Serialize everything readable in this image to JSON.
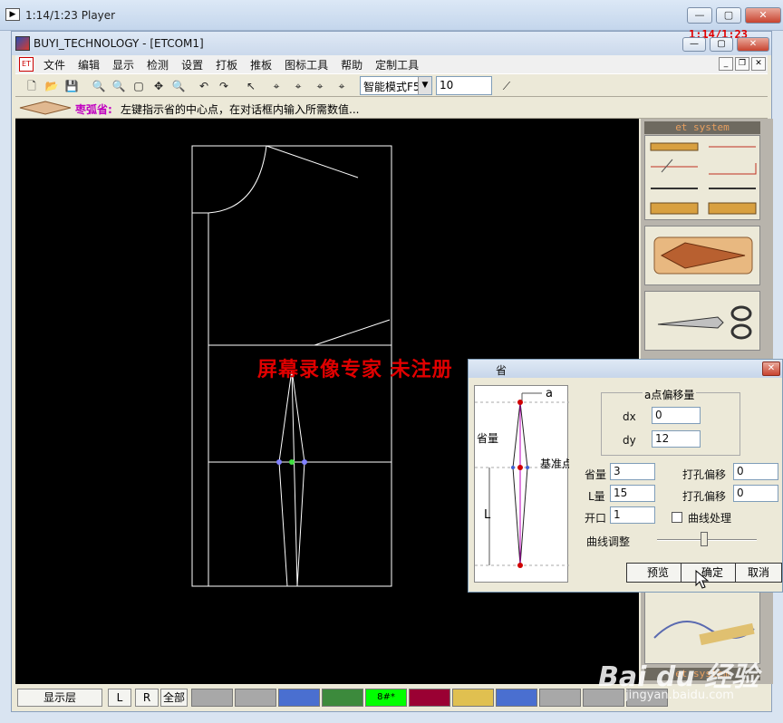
{
  "player": {
    "title": "1:14/1:23 Player"
  },
  "app": {
    "title": "BUYI_TECHNOLOGY - [ETCOM1]",
    "timer": "1:14/1:23",
    "menu": [
      "文件",
      "编辑",
      "显示",
      "检测",
      "设置",
      "打板",
      "推板",
      "图标工具",
      "帮助",
      "定制工具"
    ]
  },
  "toolbar": {
    "mode_select": "智能模式F5",
    "value_input": "10"
  },
  "hint": {
    "label": "枣弧省:",
    "text": "左键指示省的中心点，在对话框内输入所需数值..."
  },
  "palette": {
    "header_top": "et system",
    "header_bottom": "et system"
  },
  "statusbar": {
    "layer_button": "显示层",
    "l_button": "L",
    "r_button": "R",
    "all_button": "全部",
    "swatch_label": "8#*",
    "colors": [
      "#a8a8a8",
      "#a8a8a8",
      "#4a6fd0",
      "#3c8a3c",
      "#00ff00",
      "#9a0033",
      "#e0c050",
      "#4a6fd0",
      "#a8a8a8",
      "#a8a8a8",
      "#a8a8a8"
    ]
  },
  "dialog": {
    "title": "省",
    "preview": {
      "label_a": "a",
      "label_dart": "省量",
      "label_base": "基准点",
      "label_L": "L"
    },
    "offset_group": {
      "title": "a点偏移量",
      "dx_label": "dx",
      "dx_value": "0",
      "dy_label": "dy",
      "dy_value": "12"
    },
    "dart_amount_label": "省量",
    "dart_amount_value": "3",
    "l_amount_label": "L量",
    "l_amount_value": "15",
    "opening_label": "开口",
    "opening_value": "1",
    "hole_offset1_label": "打孔偏移",
    "hole_offset1_value": "0",
    "hole_offset2_label": "打孔偏移",
    "hole_offset2_value": "0",
    "curve_process_label": "曲线处理",
    "curve_adjust_label": "曲线调整",
    "preview_button": "预览",
    "ok_button": "确定",
    "cancel_button": "取消"
  },
  "watermark": "屏幕录像专家 未注册",
  "baidu": {
    "logo": "Bai du 经验",
    "url": "jingyan.baidu.com"
  }
}
